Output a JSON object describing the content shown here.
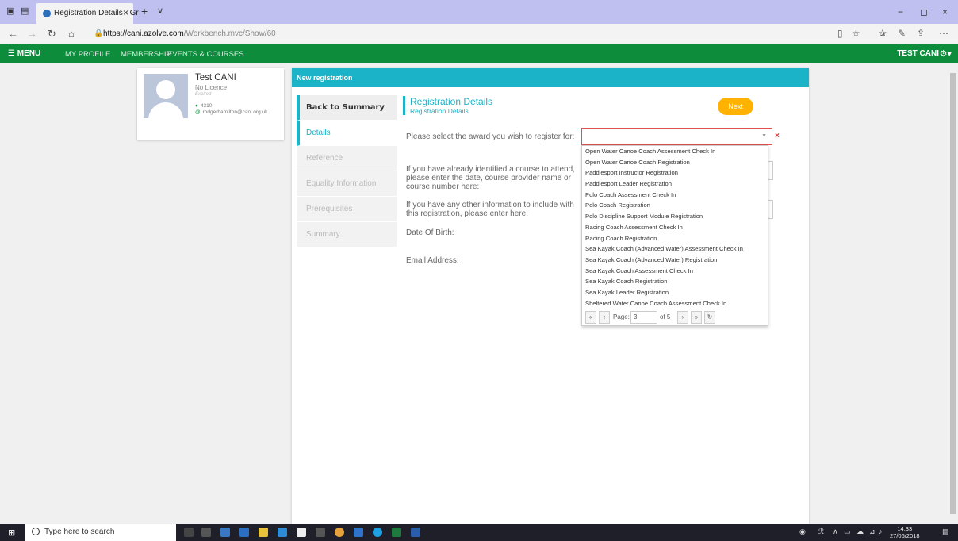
{
  "browser": {
    "tab_title": "Registration Details - Gr",
    "url_domain": "https://cani.azolve.com",
    "url_path": "/Workbench.mvc/Show/60"
  },
  "nav": {
    "menu_label": "MENU",
    "items": [
      "MY PROFILE",
      "MEMBERSHIP",
      "EVENTS & COURSES"
    ],
    "user_label": "TEST CANI"
  },
  "profile": {
    "name": "Test CANI",
    "licence": "No Licence",
    "status": "Expired",
    "member_id": "4310",
    "email": "rodgerhamilton@cani.org.uk"
  },
  "panel": {
    "header": "New registration",
    "steps": [
      "Back to Summary",
      "Details",
      "Reference",
      "Equality Information",
      "Prerequisites",
      "Summary"
    ],
    "section_title": "Registration Details",
    "section_subtitle": "Registration Details",
    "next_label": "Next",
    "fields": {
      "award": "Please select the award you wish to register for:",
      "course_line1": "If you have already identified a course to attend,",
      "course_line2": "please enter the date, course provider name or",
      "course_line3": "course number here:",
      "other_line1": "If you have any other information to include with",
      "other_line2": "this registration, please enter here:",
      "dob": "Date Of Birth:",
      "email": "Email Address:"
    },
    "select_value": "",
    "error_mark": "×"
  },
  "dropdown": {
    "options": [
      "Open Water Canoe Coach Assessment Check In",
      "Open Water Canoe Coach Registration",
      "Paddlesport Instructor Registration",
      "Paddlesport Leader Registration",
      "Polo Coach Assessment Check In",
      "Polo Coach Registration",
      "Polo Discipline Support Module Registration",
      "Racing Coach Assessment Check In",
      "Racing Coach Registration",
      "Sea Kayak Coach (Advanced Water) Assessment Check In",
      "Sea Kayak Coach (Advanced Water) Registration",
      "Sea Kayak Coach Assessment Check In",
      "Sea Kayak Coach Registration",
      "Sea Kayak Leader Registration",
      "Sheltered Water Canoe Coach Assessment Check In"
    ],
    "page_label": "Page:",
    "page_value": "3",
    "page_of": "of 5"
  },
  "taskbar": {
    "search_placeholder": "Type here to search",
    "time": "14:33",
    "date": "27/06/2018"
  }
}
